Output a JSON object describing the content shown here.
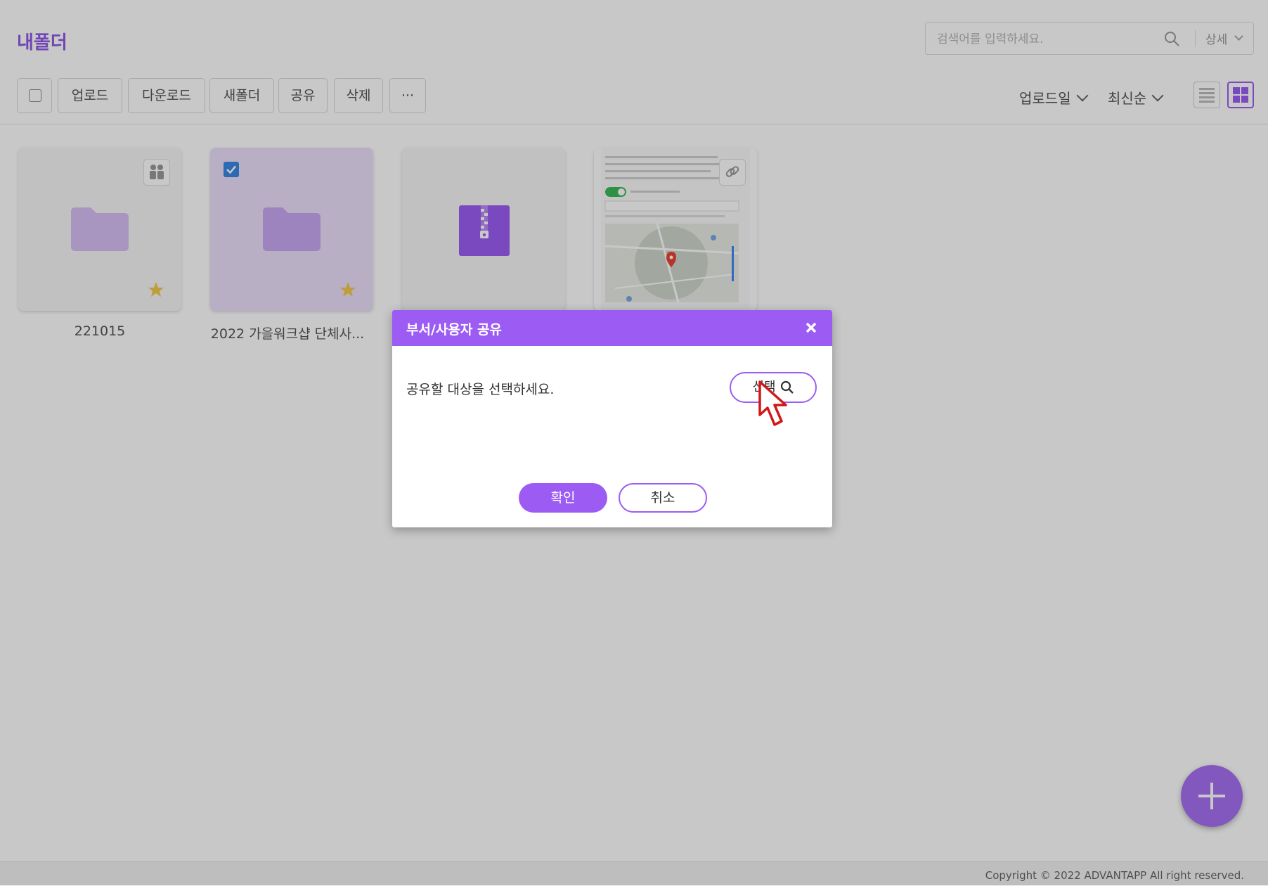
{
  "header": {
    "title": "내폴더",
    "search_placeholder": "검색어를 입력하세요.",
    "detail_label": "상세"
  },
  "toolbar": {
    "buttons": [
      "업로드",
      "다운로드",
      "새폴더",
      "공유",
      "삭제",
      "···"
    ]
  },
  "sort": {
    "field_label": "업로드일",
    "order_label": "최신순"
  },
  "files": [
    {
      "name": "221015",
      "type": "folder",
      "starred": true,
      "shared": true,
      "selected": false
    },
    {
      "name": "2022 가을워크샵 단체사...",
      "type": "folder",
      "starred": true,
      "shared": false,
      "selected": true
    },
    {
      "name": "",
      "type": "zip",
      "starred": false,
      "shared": false,
      "selected": false
    },
    {
      "name": "",
      "type": "image",
      "starred": false,
      "shared": false,
      "linked": true,
      "selected": false
    }
  ],
  "modal": {
    "title": "부서/사용자 공유",
    "message": "공유할 대상을 선택하세요.",
    "select_label": "선택",
    "ok_label": "확인",
    "cancel_label": "취소"
  },
  "footer": {
    "copyright": "Copyright © 2022 ADVANTAPP All right reserved."
  },
  "colors": {
    "accent": "#9c5cf4",
    "title": "#8e5ae6",
    "folder": "#d7c0f5",
    "zip": "#9c5cf4",
    "star": "#f2c94c"
  }
}
